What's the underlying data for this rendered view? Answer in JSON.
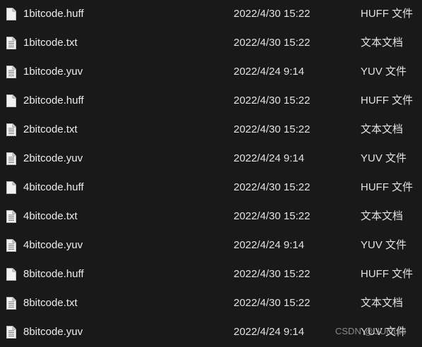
{
  "files": [
    {
      "name": "1bitcode.huff",
      "date": "2022/4/30 15:22",
      "type": "HUFF 文件",
      "icon": "blank-file-icon"
    },
    {
      "name": "1bitcode.txt",
      "date": "2022/4/30 15:22",
      "type": "文本文档",
      "icon": "text-file-icon"
    },
    {
      "name": "1bitcode.yuv",
      "date": "2022/4/24 9:14",
      "type": "YUV 文件",
      "icon": "text-file-icon"
    },
    {
      "name": "2bitcode.huff",
      "date": "2022/4/30 15:22",
      "type": "HUFF 文件",
      "icon": "blank-file-icon"
    },
    {
      "name": "2bitcode.txt",
      "date": "2022/4/30 15:22",
      "type": "文本文档",
      "icon": "text-file-icon"
    },
    {
      "name": "2bitcode.yuv",
      "date": "2022/4/24 9:14",
      "type": "YUV 文件",
      "icon": "text-file-icon"
    },
    {
      "name": "4bitcode.huff",
      "date": "2022/4/30 15:22",
      "type": "HUFF 文件",
      "icon": "blank-file-icon"
    },
    {
      "name": "4bitcode.txt",
      "date": "2022/4/30 15:22",
      "type": "文本文档",
      "icon": "text-file-icon"
    },
    {
      "name": "4bitcode.yuv",
      "date": "2022/4/24 9:14",
      "type": "YUV 文件",
      "icon": "text-file-icon"
    },
    {
      "name": "8bitcode.huff",
      "date": "2022/4/30 15:22",
      "type": "HUFF 文件",
      "icon": "blank-file-icon"
    },
    {
      "name": "8bitcode.txt",
      "date": "2022/4/30 15:22",
      "type": "文本文档",
      "icon": "text-file-icon"
    },
    {
      "name": "8bitcode.yuv",
      "date": "2022/4/24 9:14",
      "type": "YUV 文件",
      "icon": "text-file-icon"
    }
  ],
  "watermark": "CSDN @UUctute",
  "colors": {
    "background": "#191919",
    "text": "#e6e6e6",
    "icon_fill": "#f2f2f2",
    "icon_lines": "#7a7a7a"
  }
}
